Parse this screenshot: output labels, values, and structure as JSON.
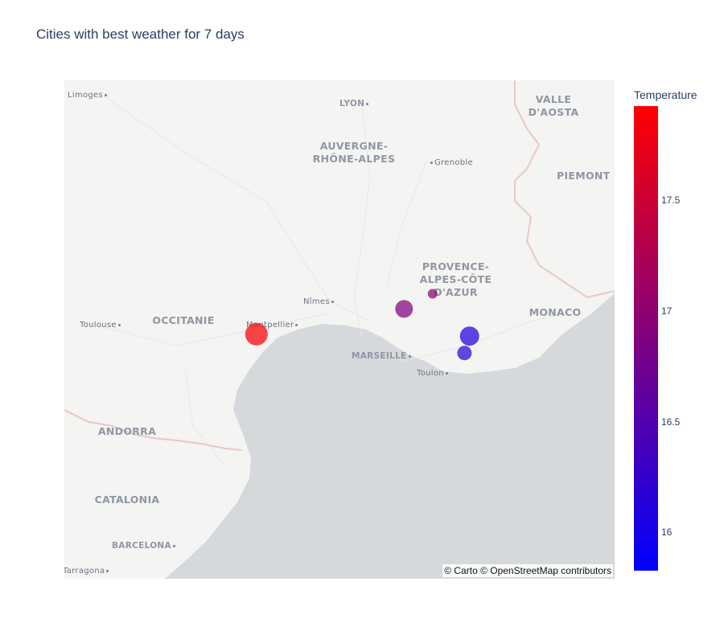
{
  "chart_data": {
    "type": "scatter_mapbox",
    "title": "Cities with best weather for 7 days",
    "color_axis": {
      "title": "Temperature",
      "range": [
        15.83,
        17.93
      ],
      "ticks": [
        "17.5",
        "17",
        "16.5",
        "16"
      ],
      "tick_values": [
        17.5,
        17.0,
        16.5,
        16.0
      ],
      "colorscale": [
        "#0000ff",
        "#800080",
        "#ff0000"
      ]
    },
    "points": [
      {
        "lon": 2.1,
        "lat": 43.5,
        "temperature": 17.9,
        "size": 14
      },
      {
        "lon": 4.42,
        "lat": 43.77,
        "temperature": 16.9,
        "size": 11
      },
      {
        "lon": 4.87,
        "lat": 43.93,
        "temperature": 17.0,
        "size": 6
      },
      {
        "lon": 5.45,
        "lat": 43.48,
        "temperature": 16.1,
        "size": 12
      },
      {
        "lon": 5.37,
        "lat": 43.3,
        "temperature": 16.2,
        "size": 9
      }
    ]
  },
  "map": {
    "attribution": "© Carto © OpenStreetMap contributors",
    "regions": [
      "AUVERGNE-\nRHÔNE-ALPES",
      "PROVENCE-\nALPES-CÔTE\nD'AZUR",
      "OCCITANIE",
      "ANDORRA",
      "CATALONIA",
      "VALLE\nD'AOSTA",
      "PIEMONT",
      "MONACO"
    ],
    "cities": [
      "Limoges",
      "LYON",
      "Grenoble",
      "Nîmes",
      "Montpellier",
      "Toulouse",
      "MARSEILLE",
      "Toulon",
      "BARCELONA",
      "Tarragona"
    ]
  }
}
